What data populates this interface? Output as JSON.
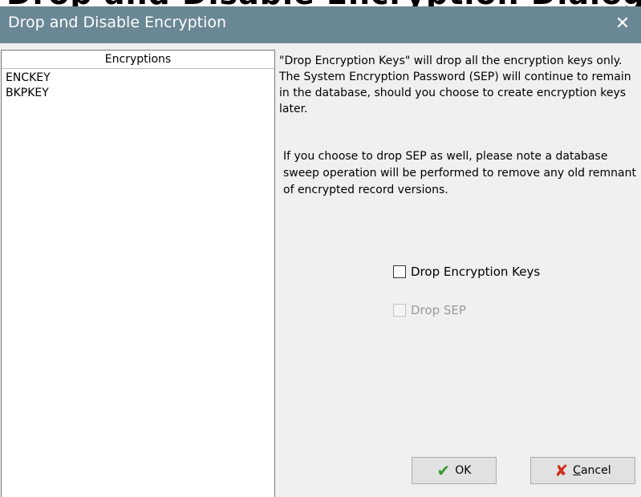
{
  "window": {
    "cropped_heading_text": "Drop and Disable Encryption Dialog",
    "title": "Drop and Disable Encryption",
    "close_glyph": "✕"
  },
  "encryptions_list": {
    "header": "Encryptions",
    "items": [
      "ENCKEY",
      "BKPKEY"
    ]
  },
  "info": {
    "paragraph1": "\"Drop Encryption Keys\" will drop all the encryption keys only. The System Encryption Password (SEP) will continue to remain in the database, should you choose to create encryption keys later.",
    "paragraph2": "If you choose to drop SEP as well, please note a database sweep operation will be performed to remove any old remnant of encrypted record versions."
  },
  "options": {
    "drop_keys_label": "Drop Encryption Keys",
    "drop_keys_checked": false,
    "drop_sep_label": "Drop SEP",
    "drop_sep_enabled": false
  },
  "buttons": {
    "ok_icon": "✔",
    "ok_label": "OK",
    "cancel_icon": "✘",
    "cancel_label_mnemonic": "C",
    "cancel_label_rest": "ancel"
  },
  "colors": {
    "titlebar": "#6a8794",
    "ok_icon": "#2e9a2e",
    "cancel_icon": "#d12d1c"
  }
}
